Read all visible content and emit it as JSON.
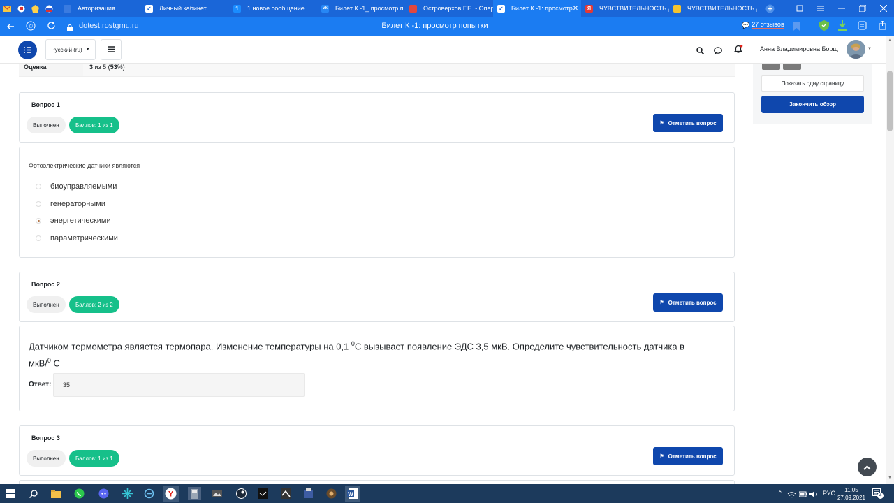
{
  "browser": {
    "tabs": [
      {
        "label": "Авторизация",
        "active": false
      },
      {
        "label": "Личный кабинет",
        "active": false
      },
      {
        "label": "1 новое сообщение",
        "active": false
      },
      {
        "label": "Билет К -1_ просмотр п",
        "active": false
      },
      {
        "label": "Островерхов Г.Е. - Опер",
        "active": false
      },
      {
        "label": "Билет К -1: просмотр",
        "active": true
      },
      {
        "label": "ЧУВСТВИТЕЛЬНОСТЬ Д",
        "active": false
      },
      {
        "label": "ЧУВСТВИТЕЛЬНОСТЬ Д",
        "active": false
      }
    ],
    "url": "dotest.rostgmu.ru",
    "page_title": "Билет К -1: просмотр попытки",
    "reviews": "27 отзывов",
    "tab_badge_1": "1"
  },
  "header": {
    "language": "Русский (ru)",
    "user_name": "Анна Владимировна Борщ"
  },
  "summary": {
    "grade_label": "Оценка",
    "grade_prefix": "3",
    "grade_mid": " из 5 (",
    "grade_percent": "53",
    "grade_suffix": "%)"
  },
  "sidebar": {
    "show_one_page": "Показать одну страницу",
    "finish_review": "Закончить обзор"
  },
  "questions": [
    {
      "title": "Вопрос 1",
      "status": "Выполнен",
      "score": "Баллов: 1 из 1",
      "flag": "Отметить вопрос"
    },
    {
      "title": "Вопрос 2",
      "status": "Выполнен",
      "score": "Баллов: 2 из 2",
      "flag": "Отметить вопрос"
    },
    {
      "title": "Вопрос 3",
      "status": "Выполнен",
      "score": "Баллов: 1 из 1",
      "flag": "Отметить вопрос"
    }
  ],
  "q1": {
    "text": "Фотоэлектрические датчики являются",
    "options": [
      "биоуправляемыми",
      "генераторными",
      "энергетическими",
      "параметрическими"
    ],
    "selected_index": 2
  },
  "q2": {
    "text_part1": "Датчиком термометра является термопара. Изменение температуры на 0,1 ",
    "sup1": "0",
    "text_part2": "С вызывает появление ЭДС 3,5 мкВ. Определите чувствительность датчика в",
    "text_line2a": "мкВ/",
    "sup2": "0",
    "text_line2b": " С",
    "answer_label": "Ответ:",
    "answer_value": "35"
  },
  "taskbar": {
    "lang": "РУС",
    "time": "11:05",
    "date": "27.09.2021",
    "notifications": "4"
  }
}
